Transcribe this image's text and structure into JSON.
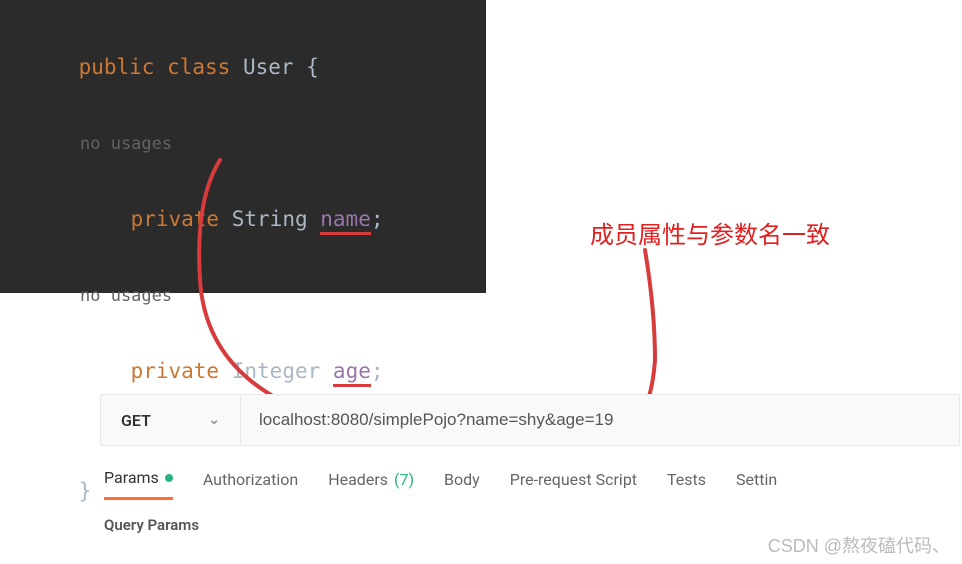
{
  "code": {
    "line1": {
      "keyword1": "public",
      "keyword2": "class",
      "className": "User",
      "brace": "{"
    },
    "usage_hint": "no usages",
    "line2": {
      "keyword": "private",
      "type": "String",
      "field": "name",
      "semi": ";"
    },
    "line3": {
      "keyword": "private",
      "type": "Integer",
      "field": "age",
      "semi": ";"
    },
    "close_brace": "}"
  },
  "annotation": {
    "text": "成员属性与参数名一致"
  },
  "postman": {
    "method": "GET",
    "url": "localhost:8080/simplePojo?name=shy&age=19",
    "tabs": {
      "params": "Params",
      "authorization": "Authorization",
      "headers": "Headers",
      "headers_count": "(7)",
      "body": "Body",
      "prerequest": "Pre-request Script",
      "tests": "Tests",
      "settings": "Settin"
    },
    "query_params_label": "Query Params"
  },
  "watermark": "CSDN @熬夜磕代码、"
}
